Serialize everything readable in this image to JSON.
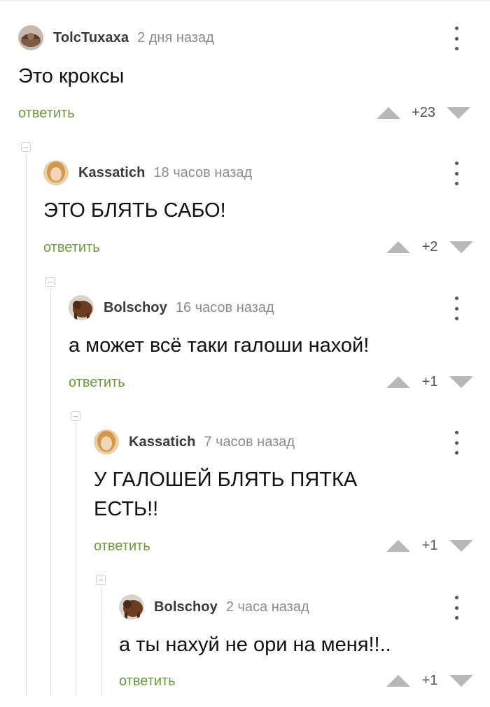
{
  "comments": [
    {
      "user": "TolcTuxaxa",
      "time": "2 дня назад",
      "text": "Это кроксы",
      "reply": "ответить",
      "score": "+23"
    },
    {
      "user": "Kassatich",
      "time": "18 часов назад",
      "text": "ЭТО БЛЯТЬ САБО!",
      "reply": "ответить",
      "score": "+2"
    },
    {
      "user": "Bolschoy",
      "time": "16 часов назад",
      "text": "а может всё таки галоши нахой!",
      "reply": "ответить",
      "score": "+1"
    },
    {
      "user": "Kassatich",
      "time": "7 часов назад",
      "text_line1": "У ГАЛОШЕЙ БЛЯТЬ ПЯТКА",
      "text_line2": "ЕСТЬ!!",
      "reply": "ответить",
      "score": "+1"
    },
    {
      "user": "Bolschoy",
      "time": "2 часа назад",
      "text": "а ты нахуй не ори на меня!!..",
      "reply": "ответить",
      "score": "+1"
    }
  ],
  "icons": {
    "more": "more-vertical-icon",
    "upvote": "triangle-up-icon",
    "downvote": "triangle-down-icon",
    "collapse": "minus-box-icon"
  },
  "colors": {
    "reply_link": "#6b9a3e",
    "vote_arrow": "#b8b8b8",
    "username": "#3a3a3a",
    "timestamp": "#8c8c8c",
    "thread_line": "#dedede"
  }
}
